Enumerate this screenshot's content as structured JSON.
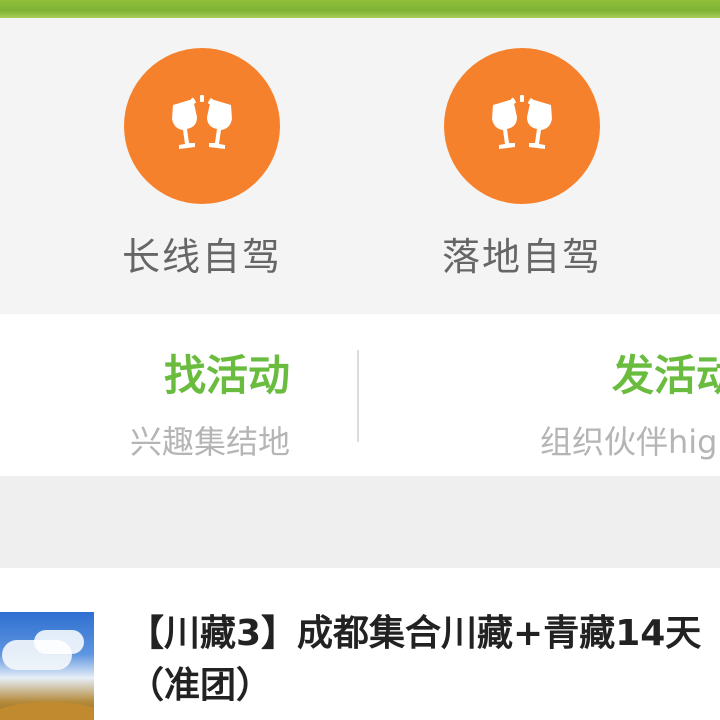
{
  "categories": [
    {
      "label": "长线自驾",
      "icon": "cheers-icon",
      "color": "#f6812c"
    },
    {
      "label": "落地自驾",
      "icon": "cheers-icon",
      "color": "#f6812c"
    }
  ],
  "actions": {
    "left": {
      "title": "找活动",
      "subtitle": "兴趣集结地"
    },
    "right": {
      "title": "发活动",
      "subtitle": "组织伙伴high"
    }
  },
  "feed": {
    "items": [
      {
        "title": "【川藏3】成都集合川藏+青藏14天（准团）"
      }
    ]
  },
  "colors": {
    "accent": "#f6812c",
    "green": "#6abc3f"
  }
}
